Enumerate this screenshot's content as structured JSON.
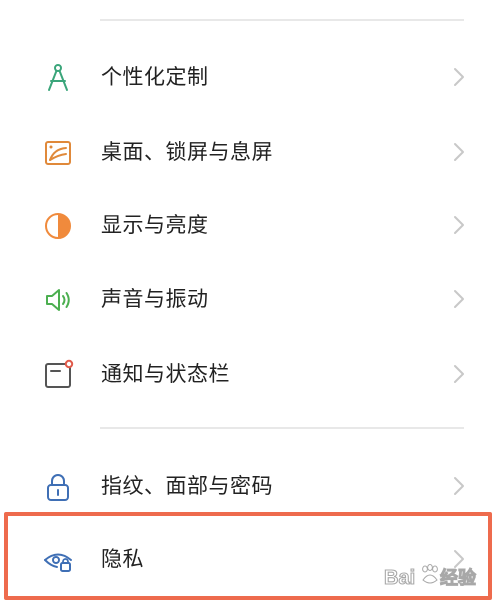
{
  "settings": {
    "items": [
      {
        "label": "个性化定制",
        "icon": "compass-icon"
      },
      {
        "label": "桌面、锁屏与息屏",
        "icon": "wallpaper-icon"
      },
      {
        "label": "显示与亮度",
        "icon": "brightness-icon"
      },
      {
        "label": "声音与振动",
        "icon": "speaker-icon"
      },
      {
        "label": "通知与状态栏",
        "icon": "notification-icon"
      },
      {
        "label": "指纹、面部与密码",
        "icon": "lock-icon"
      },
      {
        "label": "隐私",
        "icon": "privacy-eye-icon"
      }
    ]
  },
  "colors": {
    "highlight_border": "#ee6b4d",
    "compass_icon": "#3aa57a",
    "wallpaper_icon": "#e0893a",
    "brightness_icon": "#f08a3c",
    "speaker_icon": "#4caf50",
    "notification_icon": "#555555",
    "notification_dot": "#e05a4a",
    "lock_icon": "#3f6fb5",
    "privacy_icon": "#3f6fb5"
  }
}
